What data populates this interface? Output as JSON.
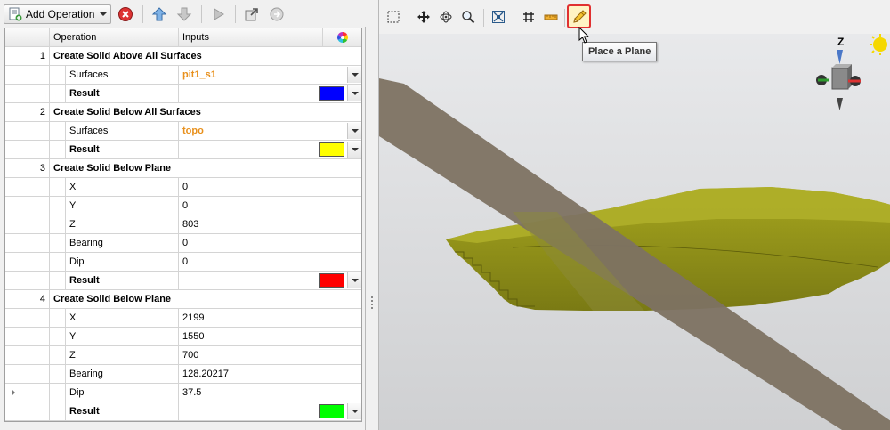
{
  "toolbar": {
    "add_operation_label": "Add Operation"
  },
  "grid": {
    "headers": {
      "operation": "Operation",
      "inputs": "Inputs"
    },
    "rows": [
      {
        "kind": "op",
        "num": "1",
        "label": "Create Solid Above All Surfaces"
      },
      {
        "kind": "param",
        "label": "Surfaces",
        "value": "pit1_s1",
        "style": "orange",
        "dropdown": true
      },
      {
        "kind": "result",
        "label": "Result",
        "color": "#0000ff"
      },
      {
        "kind": "op",
        "num": "2",
        "label": "Create Solid Below All Surfaces"
      },
      {
        "kind": "param",
        "label": "Surfaces",
        "value": "topo",
        "style": "orange",
        "dropdown": true
      },
      {
        "kind": "result",
        "label": "Result",
        "color": "#ffff00"
      },
      {
        "kind": "op",
        "num": "3",
        "label": "Create Solid Below Plane"
      },
      {
        "kind": "param",
        "label": "X",
        "value": "0"
      },
      {
        "kind": "param",
        "label": "Y",
        "value": "0"
      },
      {
        "kind": "param",
        "label": "Z",
        "value": "803"
      },
      {
        "kind": "param",
        "label": "Bearing",
        "value": "0"
      },
      {
        "kind": "param",
        "label": "Dip",
        "value": "0"
      },
      {
        "kind": "result",
        "label": "Result",
        "color": "#ff0000"
      },
      {
        "kind": "op",
        "num": "4",
        "label": "Create Solid Below Plane"
      },
      {
        "kind": "param",
        "label": "X",
        "value": "2199"
      },
      {
        "kind": "param",
        "label": "Y",
        "value": "1550"
      },
      {
        "kind": "param",
        "label": "Z",
        "value": "700"
      },
      {
        "kind": "param",
        "label": "Bearing",
        "value": "128.20217"
      },
      {
        "kind": "param",
        "label": "Dip",
        "value": "37.5",
        "current": true
      },
      {
        "kind": "result",
        "label": "Result",
        "color": "#00ff00"
      }
    ]
  },
  "view": {
    "tooltip": "Place a Plane",
    "axis_label": "Z",
    "colors": {
      "plane": "#7d7262",
      "solid": "#9a9a18",
      "solid_dark": "#6f6f10",
      "highlight": "#e03030"
    }
  },
  "icons": {
    "add_operation": "add-operation-icon",
    "delete": "delete-icon",
    "move_up": "arrow-up-icon",
    "move_down": "arrow-down-icon",
    "run": "play-icon",
    "export": "export-icon",
    "refresh": "refresh-icon",
    "select": "select-box-icon",
    "pan": "pan-icon",
    "rotate": "rotate-icon",
    "zoom": "zoom-icon",
    "zoom_extents": "zoom-extents-icon",
    "grid": "grid-icon",
    "measure": "ruler-icon",
    "place_plane": "pencil-icon",
    "color_wheel": "color-wheel-icon"
  }
}
